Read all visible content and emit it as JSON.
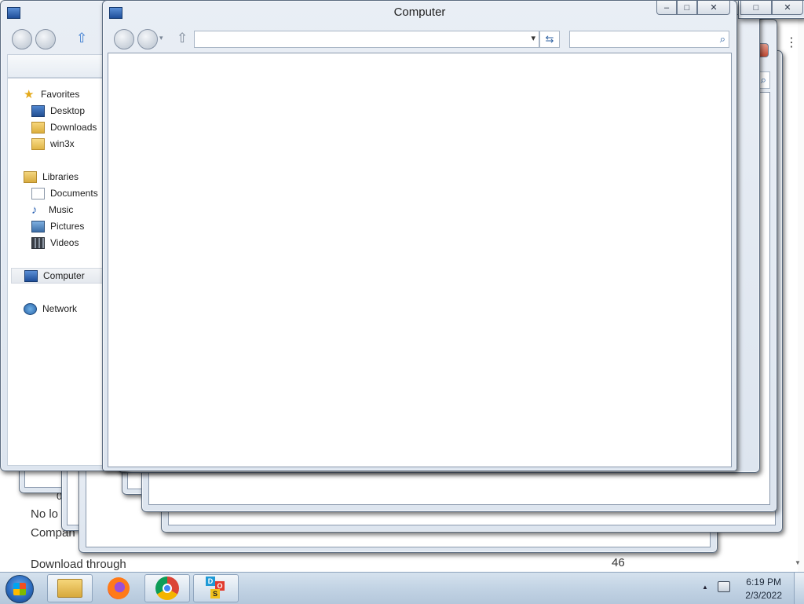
{
  "background_page": {
    "text_1": "No lo",
    "text_2": "Compan",
    "text_3": "Download through",
    "count": "46",
    "col_text": "0"
  },
  "left_explorer": {
    "favorites_label": "Favorites",
    "favorites": [
      {
        "label": "Desktop",
        "icon": "desktop-icon"
      },
      {
        "label": "Downloads",
        "icon": "downloads-folder-icon"
      },
      {
        "label": "win3x",
        "icon": "folder-icon"
      }
    ],
    "libraries_label": "Libraries",
    "libraries": [
      {
        "label": "Documents",
        "icon": "documents-icon"
      },
      {
        "label": "Music",
        "icon": "music-icon"
      },
      {
        "label": "Pictures",
        "icon": "pictures-icon"
      },
      {
        "label": "Videos",
        "icon": "videos-icon"
      }
    ],
    "computer_label": "Computer",
    "network_label": "Network"
  },
  "front_window": {
    "title": "Computer",
    "address_value": "",
    "search_placeholder": ""
  },
  "caption_glyphs": {
    "minimize": "–",
    "maximize": "□",
    "close": "✕",
    "dropdown": "▾",
    "refresh": "⇆",
    "search": "⌕",
    "up": "⇧"
  },
  "taskbar": {
    "time": "6:19 PM",
    "date": "2/3/2022",
    "apps": [
      "explorer-icon",
      "firefox-icon",
      "chrome-icon",
      "dosbox-icon"
    ],
    "dosbox_letters": [
      "D",
      "O",
      "S"
    ]
  },
  "colors": {
    "accent": "#2b6cc0",
    "window_frame": "#dde5ef"
  }
}
